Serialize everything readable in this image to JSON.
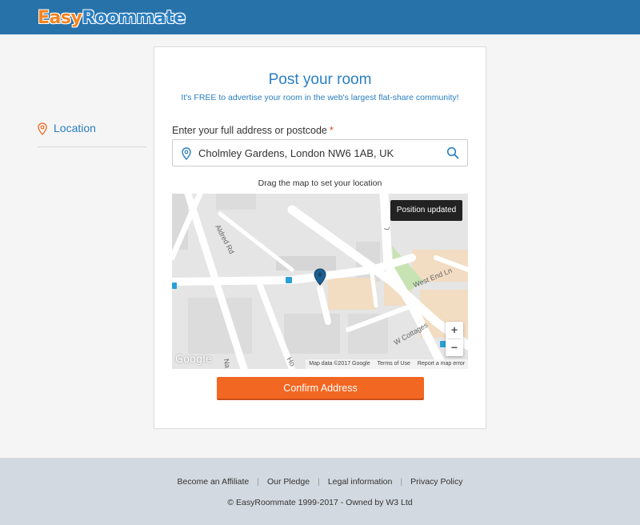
{
  "header": {
    "logo_easy": "Easy",
    "logo_room": "Roommate"
  },
  "sidebar": {
    "items": [
      {
        "label": "Location",
        "icon": "map-pin-icon"
      }
    ]
  },
  "form": {
    "title": "Post your room",
    "subtitle": "It's FREE to advertise your room in the web's largest flat-share community!",
    "address_label": "Enter your full address or postcode",
    "required_mark": "*",
    "address_value": "Cholmley Gardens, London NW6 1AB, UK",
    "drag_hint": "Drag the map to set your location",
    "confirm_label": "Confirm Address"
  },
  "map": {
    "toast": "Position updated",
    "zoom_in": "+",
    "zoom_out": "−",
    "google": "Google",
    "attribution": {
      "data": "Map data ©2017 Google",
      "terms": "Terms of Use",
      "report": "Report a map error"
    },
    "streets": {
      "alfred": "Aldred Rd",
      "west_end": "West End Ln",
      "w_cottages": "W Cottages",
      "ho": "Ho",
      "na": "Na",
      "lyn": "L"
    }
  },
  "footer": {
    "links": [
      "Become an Affiliate",
      "Our Pledge",
      "Legal information",
      "Privacy Policy"
    ],
    "divider": "|",
    "copyright": "© EasyRoommate 1999-2017 - Owned by W3 Ltd"
  },
  "colors": {
    "header": "#2872aa",
    "accent": "#2a7fc1",
    "orange": "#f26722"
  }
}
